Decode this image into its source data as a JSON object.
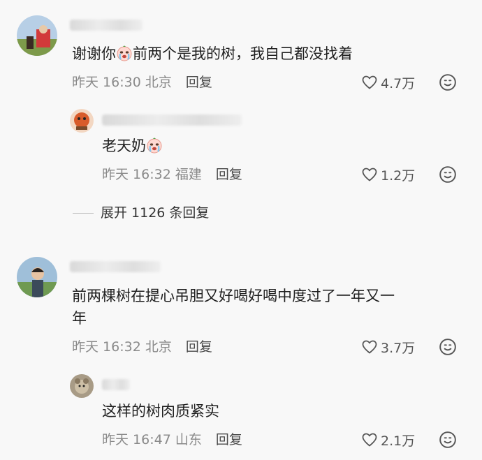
{
  "comments": [
    {
      "text_before_emoji": "谢谢你",
      "emoji": "crying-face-icon",
      "text_after_emoji": "前两个是我的树，我自己都没找着",
      "time": "昨天 16:30",
      "location": "北京",
      "reply_label": "回复",
      "likes": "4.7万",
      "replies": [
        {
          "text": "老天奶",
          "emoji": "crying-face-icon",
          "time": "昨天 16:32",
          "location": "福建",
          "reply_label": "回复",
          "likes": "1.2万"
        }
      ],
      "expand_label": "展开 1126 条回复"
    },
    {
      "text_line1": "前两棵树在提心吊胆又好喝好喝中度过了一年又一",
      "text_line2": "年",
      "time": "昨天 16:32",
      "location": "北京",
      "reply_label": "回复",
      "likes": "3.7万",
      "replies": [
        {
          "text": "这样的树肉质紧实",
          "time": "昨天 16:47",
          "location": "山东",
          "reply_label": "回复",
          "likes": "2.1万"
        }
      ]
    }
  ],
  "colors": {
    "background": "#f8f8f8",
    "meta": "#8a8a8a",
    "text": "#1f1f1f"
  }
}
